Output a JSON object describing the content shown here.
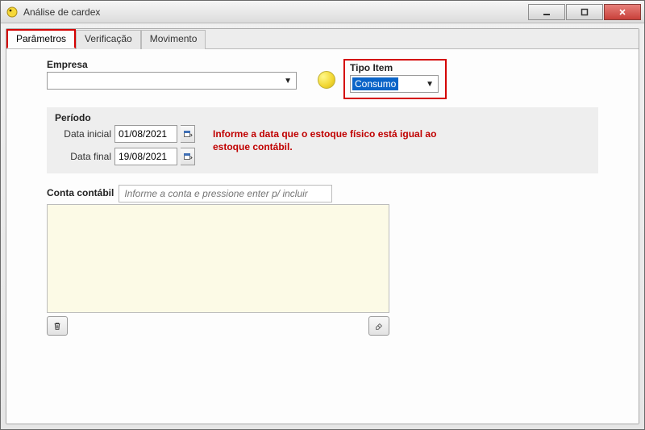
{
  "window": {
    "title": "Análise de cardex"
  },
  "tabs": {
    "active": "Parâmetros",
    "items": [
      "Parâmetros",
      "Verificação",
      "Movimento"
    ]
  },
  "empresa": {
    "label": "Empresa",
    "value": ""
  },
  "tipo_item": {
    "label": "Tipo Item",
    "value": "Consumo"
  },
  "periodo": {
    "title": "Período",
    "data_inicial_label": "Data inicial",
    "data_inicial_value": "01/08/2021",
    "data_final_label": "Data final",
    "data_final_value": "19/08/2021",
    "note": "Informe a data que o estoque físico está igual ao estoque contábil."
  },
  "conta": {
    "label": "Conta contábil",
    "placeholder": "Informe a conta e pressione enter p/ incluir"
  }
}
